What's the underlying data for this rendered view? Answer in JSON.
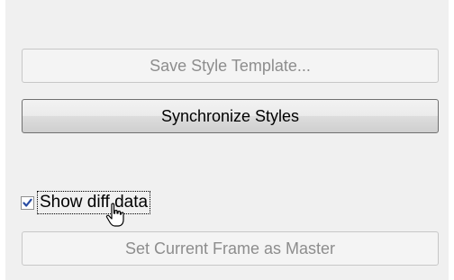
{
  "buttons": {
    "save_style_template": "Save Style Template...",
    "synchronize_styles": "Synchronize Styles",
    "set_current_frame_master": "Set Current Frame as Master"
  },
  "options": {
    "show_diff_data_label": "Show diff data",
    "show_diff_data_checked": true
  },
  "icons": {
    "checkbox_check": "checkmark-icon",
    "mouse_cursor": "hand-pointer-cursor-icon"
  },
  "colors": {
    "panel_background": "#f0f0f0",
    "check_color": "#2a4da3",
    "disabled_text": "#8d8d8d"
  }
}
